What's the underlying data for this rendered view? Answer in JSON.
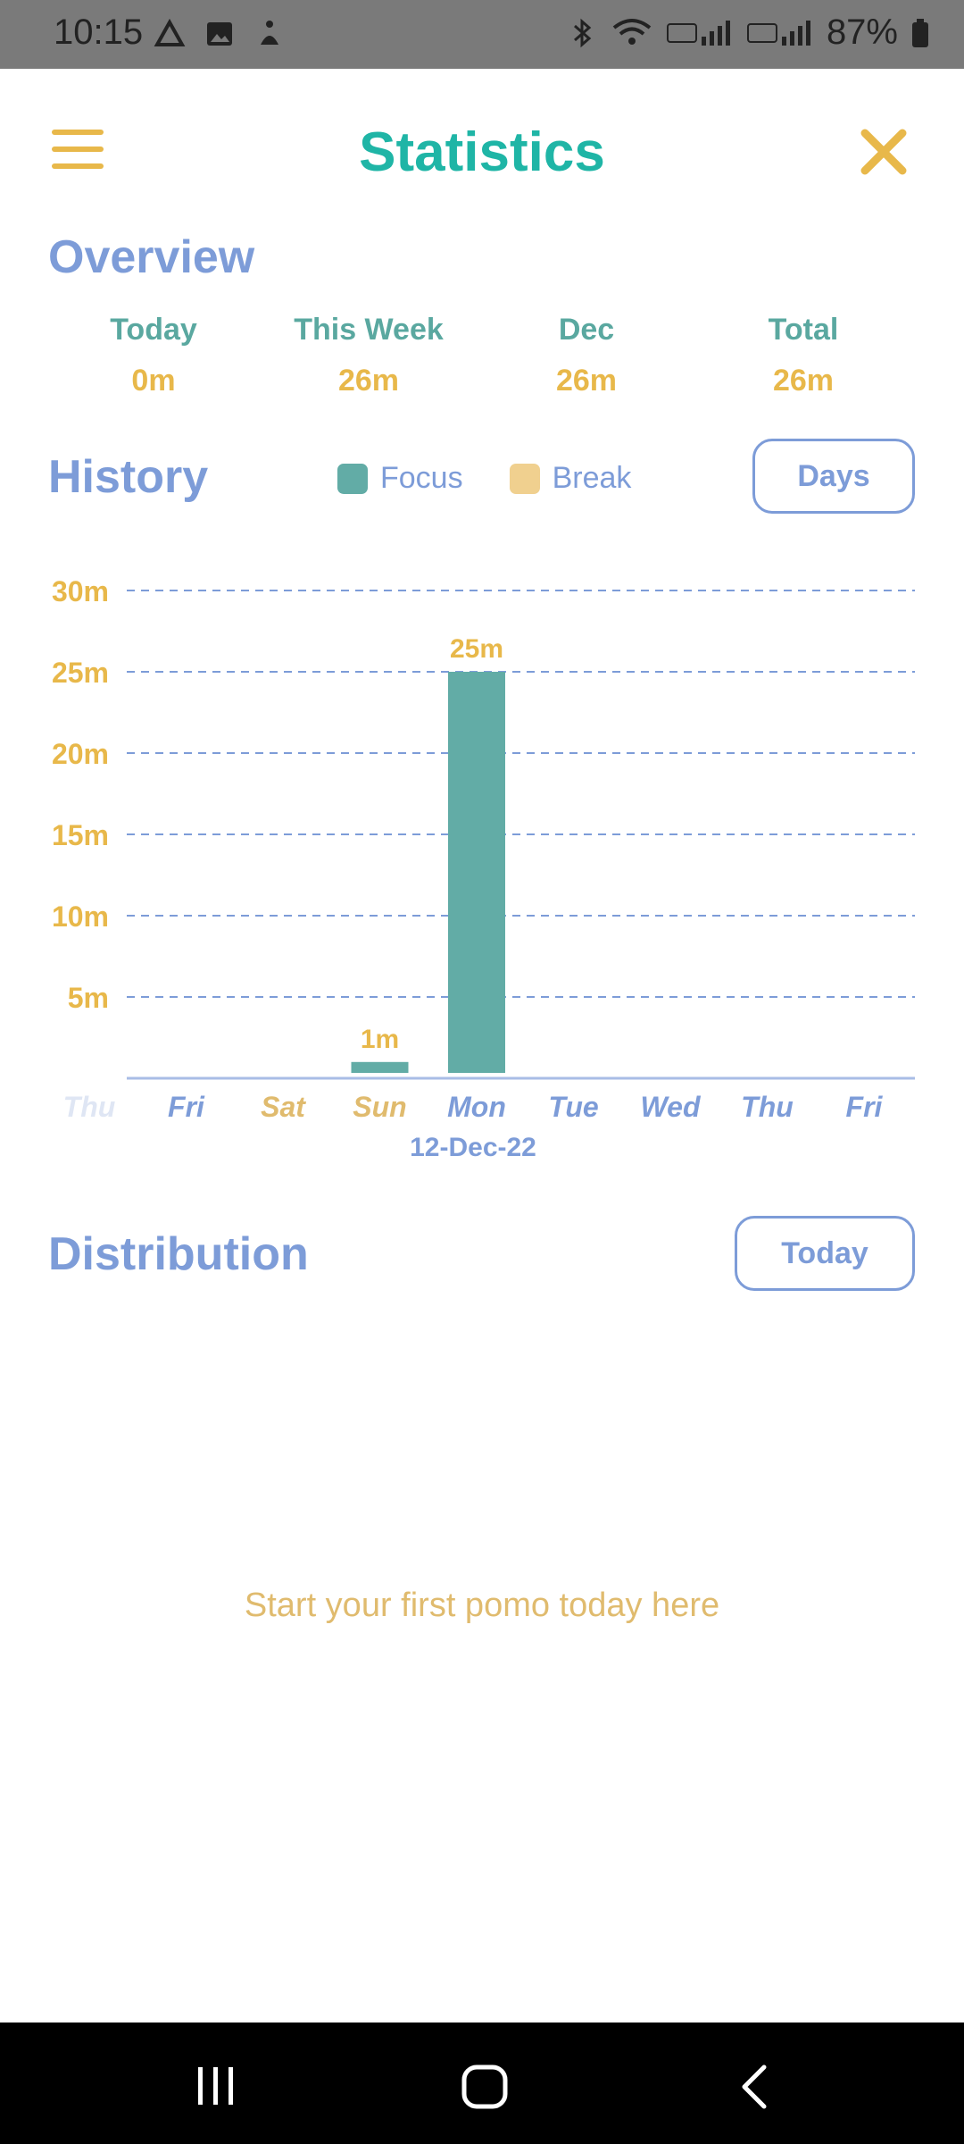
{
  "status_bar": {
    "time": "10:15",
    "battery": "87%"
  },
  "header": {
    "title": "Statistics"
  },
  "overview": {
    "title": "Overview",
    "items": [
      {
        "label": "Today",
        "value": "0m"
      },
      {
        "label": "This Week",
        "value": "26m"
      },
      {
        "label": "Dec",
        "value": "26m"
      },
      {
        "label": "Total",
        "value": "26m"
      }
    ]
  },
  "history": {
    "title": "History",
    "legend_focus": "Focus",
    "legend_break": "Break",
    "range_button": "Days",
    "selected_date": "12-Dec-22"
  },
  "distribution": {
    "title": "Distribution",
    "range_button": "Today",
    "empty_message": "Start your first pomo today here"
  },
  "colors": {
    "focus": "#62aca6",
    "break": "#f0d08f",
    "accent_yellow": "#e8b84a",
    "accent_blue": "#7d9cd8",
    "title_teal": "#1fb5a6"
  },
  "chart_data": {
    "type": "bar",
    "categories": [
      "Thu",
      "Fri",
      "Sat",
      "Sun",
      "Mon",
      "Tue",
      "Wed",
      "Thu",
      "Fri"
    ],
    "series": [
      {
        "name": "Focus",
        "values": [
          0,
          0,
          0,
          1,
          25,
          0,
          0,
          0,
          0
        ]
      }
    ],
    "value_labels": [
      "",
      "",
      "",
      "1m",
      "25m",
      "",
      "",
      "",
      ""
    ],
    "y_ticks": [
      "5m",
      "10m",
      "15m",
      "20m",
      "25m",
      "30m"
    ],
    "y_tick_values": [
      5,
      10,
      15,
      20,
      25,
      30
    ],
    "ylim": [
      0,
      30
    ],
    "grid": true,
    "category_colors": [
      "#dfe6f4",
      "#7d9cd8",
      "#e0bb6e",
      "#e0bb6e",
      "#7d9cd8",
      "#7d9cd8",
      "#7d9cd8",
      "#7d9cd8",
      "#7d9cd8"
    ]
  }
}
